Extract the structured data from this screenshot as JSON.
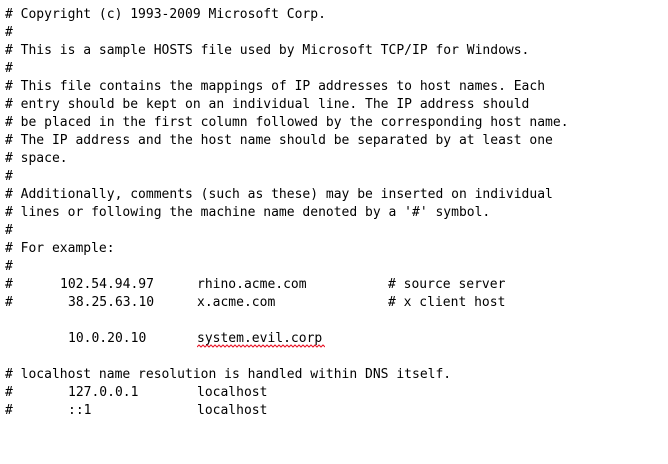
{
  "editor": {
    "comments": [
      "# Copyright (c) 1993-2009 Microsoft Corp.",
      "#",
      "# This is a sample HOSTS file used by Microsoft TCP/IP for Windows.",
      "#",
      "# This file contains the mappings of IP addresses to host names. Each",
      "# entry should be kept on an individual line. The IP address should",
      "# be placed in the first column followed by the corresponding host name.",
      "# The IP address and the host name should be separated by at least one",
      "# space.",
      "#",
      "# Additionally, comments (such as these) may be inserted on individual",
      "# lines or following the machine name denoted by a '#' symbol.",
      "#",
      "# For example:",
      "#"
    ],
    "examples": [
      {
        "hash": "#",
        "ip": "102.54.94.97",
        "host": "rhino.acme.com",
        "comment": "# source server"
      },
      {
        "hash": "#",
        "ip": "38.25.63.10",
        "host": "x.acme.com",
        "comment": "# x client host"
      }
    ],
    "entry": {
      "ip": "10.0.20.10",
      "host": "system.evil.corp"
    },
    "localhost_comment": "# localhost name resolution is handled within DNS itself.",
    "localhost_entries": [
      {
        "hash": "#",
        "ip": "127.0.0.1",
        "host": "localhost"
      },
      {
        "hash": "#",
        "ip": "::1",
        "host": "localhost"
      }
    ],
    "spellcheck_color": "#e81123"
  }
}
